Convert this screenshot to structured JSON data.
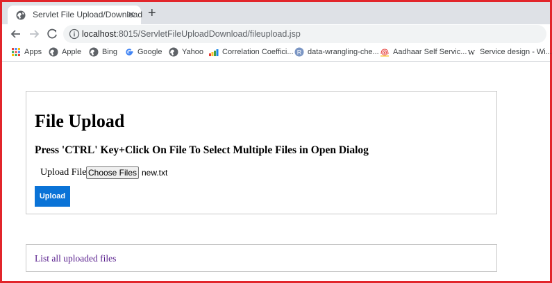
{
  "browser": {
    "tab": {
      "title": "Servlet File Upload/Download",
      "close": "✕"
    },
    "new_tab": "+",
    "url": {
      "host": "localhost",
      "path": ":8015/ServletFileUploadDownload/fileupload.jsp"
    },
    "bookmarks": [
      {
        "label": "Apps",
        "icon": "apps-grid-icon"
      },
      {
        "label": "Apple",
        "icon": "globe-icon"
      },
      {
        "label": "Bing",
        "icon": "globe-icon"
      },
      {
        "label": "Google",
        "icon": "google-g-icon"
      },
      {
        "label": "Yahoo",
        "icon": "globe-icon"
      },
      {
        "label": "Correlation Coeffici...",
        "icon": "bar-chart-icon"
      },
      {
        "label": "data-wrangling-che...",
        "icon": "r-logo-icon"
      },
      {
        "label": "Aadhaar Self Servic...",
        "icon": "fingerprint-icon"
      },
      {
        "label": "Service design - Wi...",
        "icon": "wikipedia-w-icon"
      }
    ]
  },
  "page": {
    "heading": "File Upload",
    "subheading": "Press 'CTRL' Key+Click On File To Select Multiple Files in Open Dialog",
    "upload_label": "Upload File:",
    "choose_button": "Choose Files",
    "chosen_file": "new.txt",
    "upload_button": "Upload",
    "list_link": "List all uploaded files"
  },
  "colors": {
    "frame": "#e2252b",
    "upload_button": "#0a73d7",
    "visited_link": "#551a8b"
  }
}
